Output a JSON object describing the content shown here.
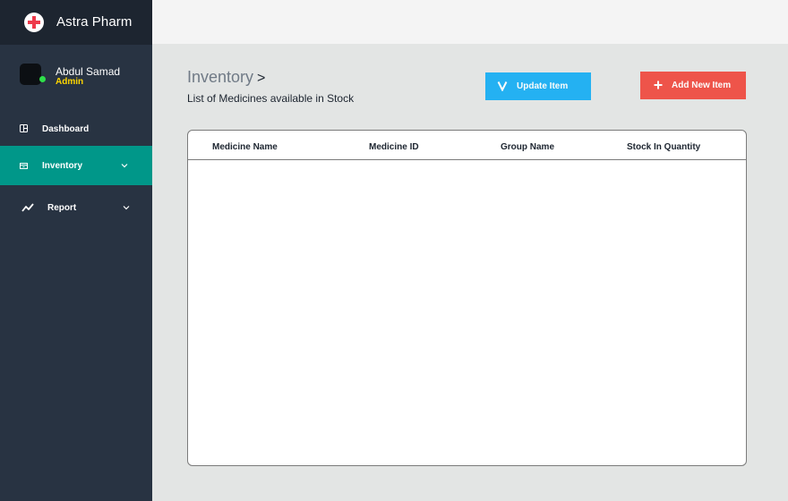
{
  "app": {
    "brand_name": "Astra Pharm",
    "logo_icon": "medical-cross-icon"
  },
  "user": {
    "name": "Abdul Samad",
    "role": "Admin",
    "status": "online"
  },
  "sidebar": {
    "items": [
      {
        "label": "Dashboard",
        "icon": "dashboard-icon",
        "active": false,
        "has_submenu": false
      },
      {
        "label": "Inventory",
        "icon": "inventory-icon",
        "active": true,
        "has_submenu": true
      },
      {
        "label": "Report",
        "icon": "report-chart-icon",
        "active": false,
        "has_submenu": true
      }
    ]
  },
  "page": {
    "title": "Inventory",
    "title_arrow": ">",
    "subtitle": "List of Medicines available in Stock"
  },
  "actions": {
    "update_label": "Update Item",
    "add_label": "Add New Item"
  },
  "table": {
    "columns": [
      "Medicine Name",
      "Medicine ID",
      "Group Name",
      "Stock In Quantity"
    ],
    "rows": []
  },
  "colors": {
    "sidebar_bg": "#283342",
    "brand_bg": "#1d2530",
    "active_item": "#009789",
    "update_button": "#03a9f5",
    "add_button": "#f0483e",
    "role_text": "#fed600",
    "online_dot": "#2ede4a"
  }
}
